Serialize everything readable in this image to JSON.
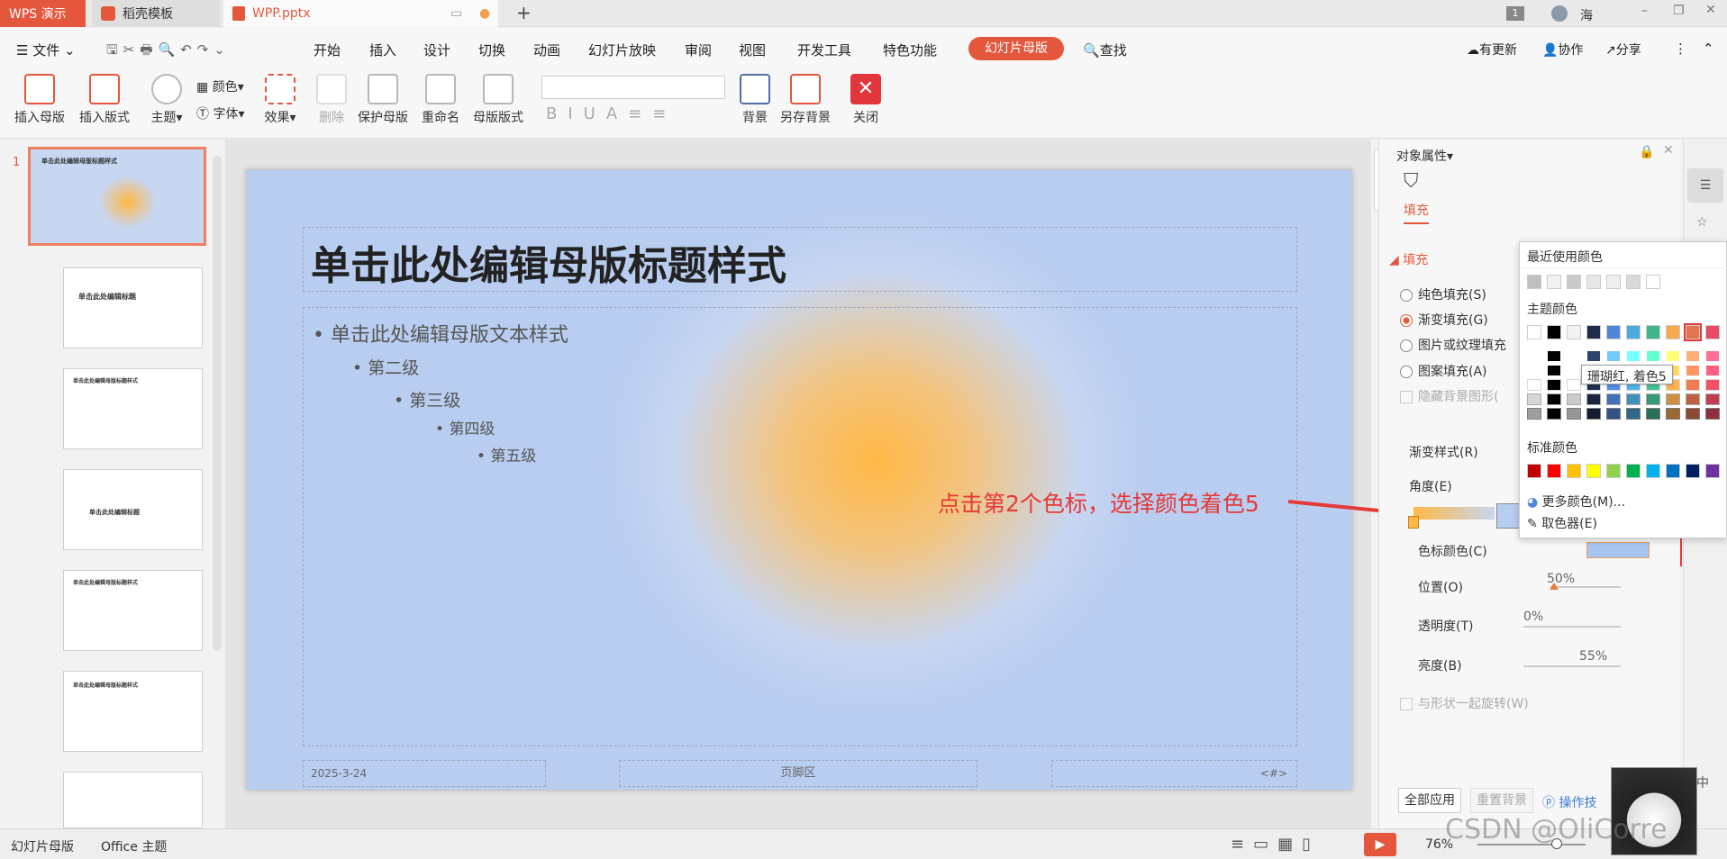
{
  "titlebar": {
    "app_tab": "WPS 演示",
    "template_tab": "稻壳模板",
    "file_tab": "WPP.pptx",
    "badge": "1",
    "user": "海"
  },
  "menubar": {
    "file": "文件",
    "items": [
      "开始",
      "插入",
      "设计",
      "切换",
      "动画",
      "幻灯片放映",
      "审阅",
      "视图",
      "开发工具",
      "特色功能"
    ],
    "active": "幻灯片母版",
    "search": "查找",
    "update": "有更新",
    "collab": "协作",
    "share": "分享"
  },
  "ribbon": {
    "insert_master": "插入母版",
    "insert_layout": "插入版式",
    "theme": "主题",
    "color": "颜色",
    "font": "字体",
    "effect": "效果",
    "delete": "删除",
    "protect_master": "保护母版",
    "rename": "重命名",
    "master_layout": "母版版式",
    "background": "背景",
    "save_background": "另存背景",
    "close": "关闭"
  },
  "thumbnails": {
    "slide_number": "1",
    "master_title": "单击此处编辑母版标题样式",
    "layout2_title": "单击此处编辑标题",
    "layout3_title": "单击此处编辑母版标题样式",
    "layout4_title": "单击此处编辑标题",
    "layout5_title": "单击此处编辑母版标题样式",
    "layout6_title": "单击此处编辑母版标题样式"
  },
  "slide": {
    "title": "单击此处编辑母版标题样式",
    "level1": "单击此处编辑母版文本样式",
    "level2": "第二级",
    "level3": "第三级",
    "level4": "第四级",
    "level5": "第五级",
    "date": "2025-3-24",
    "footer": "页脚区",
    "page": "<#>"
  },
  "annotation": "点击第2个色标，选择颜色着色5",
  "panel": {
    "title": "对象属性",
    "tab_fill": "填充",
    "section_fill": "填充",
    "solid": "纯色填充(S)",
    "gradient": "渐变填充(G)",
    "picture": "图片或纹理填充",
    "pattern": "图案填充(A)",
    "hide_bg": "隐藏背景图形(",
    "gradient_style": "渐变样式(R)",
    "angle": "角度(E)",
    "stop_color": "色标颜色(C)",
    "position": "位置(O)",
    "position_value": "50%",
    "transparency": "透明度(T)",
    "transparency_value": "0%",
    "brightness": "亮度(B)",
    "brightness_value": "55%",
    "rotate_with_shape": "与形状一起旋转(W)",
    "apply_all": "全部应用",
    "reset_bg": "重置背景",
    "tips": "操作技"
  },
  "color_popup": {
    "recent": "最近使用颜色",
    "theme": "主题颜色",
    "tooltip": "珊瑚红, 着色5",
    "standard": "标准颜色",
    "more": "更多颜色(M)...",
    "picker": "取色器(E)",
    "recent_colors": [
      "#bfbfbf",
      "#f2f2f2",
      "#c9c9c9",
      "#e7e7e7",
      "#eeeeee",
      "#d9d9d9",
      "#ffffff"
    ],
    "theme_colors": [
      "#ffffff",
      "#000000",
      "#f2f2f2",
      "#1f2d4b",
      "#4f86d8",
      "#4eaadc",
      "#41b68b",
      "#f7a94d",
      "#e2744f",
      "#e84a63"
    ],
    "standard_colors": [
      "#c00000",
      "#ff0000",
      "#ffc000",
      "#ffff00",
      "#92d050",
      "#00b050",
      "#00b0f0",
      "#0070c0",
      "#002060",
      "#7030a0"
    ]
  },
  "statusbar": {
    "mode": "幻灯片母版",
    "theme": "Office 主题",
    "zoom": "76%",
    "ime": "中"
  },
  "watermark": "CSDN @OliCorre"
}
